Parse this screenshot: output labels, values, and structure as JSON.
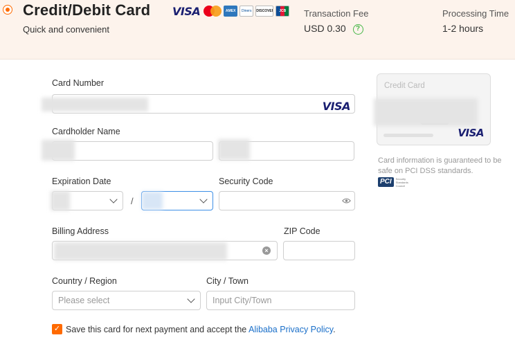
{
  "header": {
    "title": "Credit/Debit Card",
    "subtitle": "Quick and convenient",
    "brands": {
      "visa": "VISA",
      "amex": "AMEX",
      "diners": "Diners Club",
      "discover": "DISCOVER",
      "jcb": "JCB"
    },
    "transaction_fee_label": "Transaction Fee",
    "transaction_fee_value": "USD 0.30",
    "help_glyph": "?",
    "processing_time_label": "Processing Time",
    "processing_time_value": "1-2 hours",
    "accent_color": "#ff6a00"
  },
  "form": {
    "card_number_label": "Card Number",
    "card_brand": "VISA",
    "cardholder_name_label": "Cardholder Name",
    "expiration_date_label": "Expiration Date",
    "date_separator": "/",
    "security_code_label": "Security Code",
    "billing_address_label": "Billing Address",
    "zip_code_label": "ZIP Code",
    "country_label": "Country / Region",
    "country_placeholder": "Please select",
    "city_label": "City / Town",
    "city_placeholder": "Input City/Town",
    "save_card_text": "Save this card for next payment and accept the",
    "privacy_link_text": "Alibaba Privacy Policy",
    "save_card_end": ".",
    "save_card_checked": true,
    "link_color": "#1a6fc9"
  },
  "card_preview": {
    "title": "Credit Card",
    "brand": "VISA",
    "info_line1": "Card information is guaranteed to be",
    "info_line2": "safe on PCI DSS standards.",
    "pci_mark": "PCI",
    "pci_text": "Security Standards Council"
  }
}
